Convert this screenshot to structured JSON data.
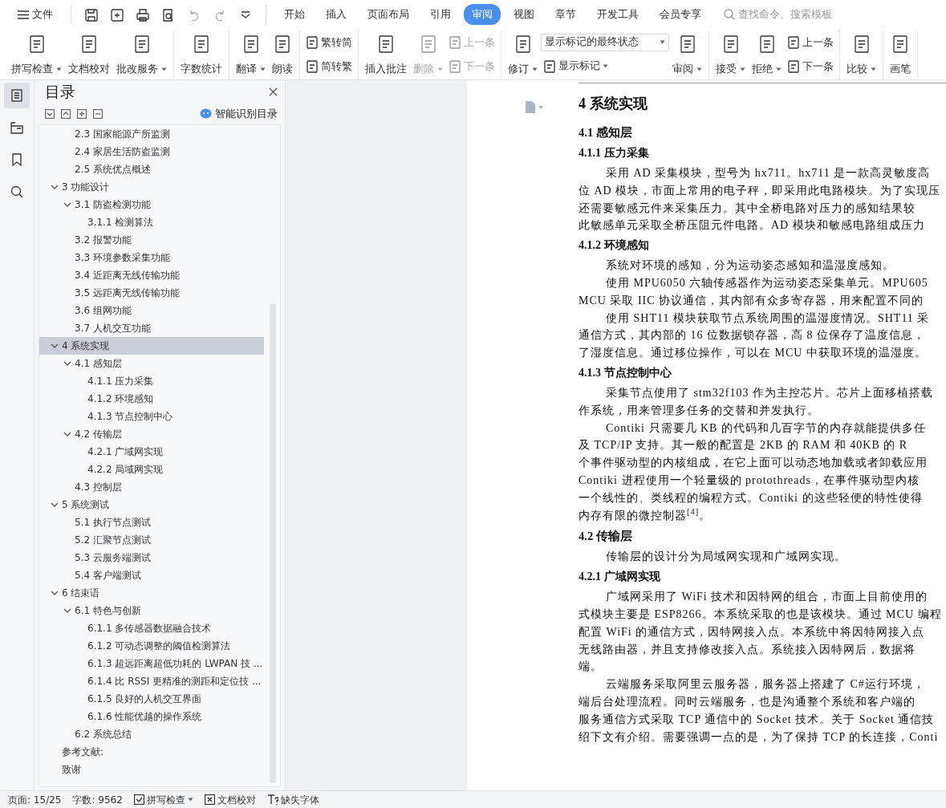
{
  "menu": {
    "label": "文件"
  },
  "tabs": [
    {
      "label": "开始",
      "selected": false
    },
    {
      "label": "插入",
      "selected": false
    },
    {
      "label": "页面布局",
      "selected": false
    },
    {
      "label": "引用",
      "selected": false
    },
    {
      "label": "审阅",
      "selected": true
    },
    {
      "label": "视图",
      "selected": false
    },
    {
      "label": "章节",
      "selected": false
    },
    {
      "label": "开发工具",
      "selected": false
    },
    {
      "label": "会员专享",
      "selected": false
    }
  ],
  "search": {
    "placeholder": "查找命令、搜索模板"
  },
  "ribbon": {
    "groups": [
      {
        "items": [
          {
            "kind": "large",
            "label": "拼写检查",
            "dropdown": true,
            "disabled": false
          },
          {
            "kind": "large",
            "label": "文档校对",
            "dropdown": false,
            "disabled": false
          },
          {
            "kind": "large",
            "label": "批改服务",
            "dropdown": true,
            "disabled": false
          }
        ]
      },
      {
        "items": [
          {
            "kind": "large",
            "label": "字数统计",
            "dropdown": false,
            "disabled": false
          }
        ]
      },
      {
        "items": [
          {
            "kind": "large",
            "label": "翻译",
            "dropdown": true,
            "disabled": false
          },
          {
            "kind": "large",
            "label": "朗读",
            "dropdown": false,
            "disabled": false
          }
        ]
      },
      {
        "items": [
          {
            "kind": "stack",
            "items": [
              {
                "kind": "small",
                "label": "繁转简",
                "dropdown": false,
                "disabled": false
              },
              {
                "kind": "small",
                "label": "简转繁",
                "dropdown": false,
                "disabled": false
              }
            ]
          }
        ]
      },
      {
        "items": [
          {
            "kind": "large",
            "label": "插入批注",
            "dropdown": false,
            "disabled": false
          },
          {
            "kind": "large",
            "label": "删除",
            "dropdown": true,
            "disabled": true
          },
          {
            "kind": "stack",
            "items": [
              {
                "kind": "small",
                "label": "上一条",
                "dropdown": false,
                "disabled": true
              },
              {
                "kind": "small",
                "label": "下一条",
                "dropdown": false,
                "disabled": true
              }
            ]
          }
        ]
      },
      {
        "items": [
          {
            "kind": "large",
            "label": "修订",
            "dropdown": true,
            "disabled": false
          },
          {
            "kind": "stack",
            "items": [
              {
                "kind": "select",
                "value": "显示标记的最终状态"
              },
              {
                "kind": "small",
                "label": "显示标记",
                "dropdown": true,
                "disabled": false
              }
            ]
          },
          {
            "kind": "large",
            "label": "审阅",
            "dropdown": true,
            "disabled": false
          }
        ]
      },
      {
        "items": [
          {
            "kind": "large",
            "label": "接受",
            "dropdown": true,
            "disabled": false
          },
          {
            "kind": "large",
            "label": "拒绝",
            "dropdown": true,
            "disabled": false
          },
          {
            "kind": "stack",
            "items": [
              {
                "kind": "small",
                "label": "上一条",
                "dropdown": false,
                "disabled": false
              },
              {
                "kind": "small",
                "label": "下一条",
                "dropdown": false,
                "disabled": false
              }
            ]
          }
        ]
      },
      {
        "items": [
          {
            "kind": "large",
            "label": "比较",
            "dropdown": true,
            "disabled": false
          }
        ]
      },
      {
        "items": [
          {
            "kind": "large",
            "label": "画笔",
            "dropdown": false,
            "disabled": false
          }
        ]
      }
    ]
  },
  "rail": [
    {
      "selected": true
    },
    {
      "selected": false
    },
    {
      "selected": false
    },
    {
      "selected": false
    }
  ],
  "toc_panel": {
    "title": "目录",
    "smart_button": "智能识别目录",
    "entries": [
      {
        "children": [
          {
            "label": "2.3  国家能源产所监测",
            "selected": false
          },
          {
            "label": "2.4  家居生活防盗监测",
            "selected": false
          },
          {
            "label": "2.5  系统优点概述",
            "selected": false
          }
        ]
      },
      {
        "label": "3  功能设计",
        "selected": false,
        "expanded": true,
        "children": [
          {
            "label": "3.1  防盗检测功能",
            "selected": false,
            "expanded": true,
            "children": [
              {
                "label": "3.1.1  检测算法",
                "selected": false
              }
            ]
          },
          {
            "label": "3.2  报警功能",
            "selected": false
          },
          {
            "label": "3.3  环境参数采集功能",
            "selected": false
          },
          {
            "label": "3.4  近距离无线传输功能",
            "selected": false
          },
          {
            "label": "3.5  远距离无线传输功能",
            "selected": false
          },
          {
            "label": "3.6  组网功能",
            "selected": false
          },
          {
            "label": "3.7  人机交互功能",
            "selected": false
          }
        ]
      },
      {
        "label": "4  系统实现",
        "selected": true,
        "expanded": true,
        "children": [
          {
            "label": "4.1  感知层",
            "selected": false,
            "expanded": true,
            "children": [
              {
                "label": "4.1.1  压力采集",
                "selected": false
              },
              {
                "label": "4.1.2  环境感知",
                "selected": false
              },
              {
                "label": "4.1.3  节点控制中心",
                "selected": false
              }
            ]
          },
          {
            "label": "4.2  传输层",
            "selected": false,
            "expanded": true,
            "children": [
              {
                "label": "4.2.1  广域网实现",
                "selected": false
              },
              {
                "label": "4.2.2  局域网实现",
                "selected": false
              }
            ]
          },
          {
            "label": "4.3  控制层",
            "selected": false
          }
        ]
      },
      {
        "label": "5  系统测试",
        "selected": false,
        "expanded": true,
        "children": [
          {
            "label": "5.1  执行节点测试",
            "selected": false
          },
          {
            "label": "5.2  汇聚节点测试",
            "selected": false
          },
          {
            "label": "5.3  云服务端测试",
            "selected": false
          },
          {
            "label": "5.4  客户端测试",
            "selected": false
          }
        ]
      },
      {
        "label": "6  结束语",
        "selected": false,
        "expanded": true,
        "children": [
          {
            "label": "6.1  特色与创新",
            "selected": false,
            "expanded": true,
            "children": [
              {
                "label": "6.1.1  多传感器数据融合技术",
                "selected": false
              },
              {
                "label": "6.1.2  可动态调整的阈值检测算法",
                "selected": false
              },
              {
                "label": "6.1.3  超远距离超低功耗的 LWPAN 技 ...",
                "selected": false
              },
              {
                "label": "6.1.4  比 RSSI 更精准的测距和定位技 ...",
                "selected": false
              },
              {
                "label": "6.1.5  良好的人机交互界面",
                "selected": false
              },
              {
                "label": "6.1.6  性能优越的操作系统",
                "selected": false
              }
            ]
          },
          {
            "label": "6.2  系统总结",
            "selected": false
          }
        ]
      },
      {
        "label": "参考文献:",
        "selected": false
      },
      {
        "label": "致谢",
        "selected": false
      }
    ]
  },
  "document": {
    "blocks": [
      {
        "kind": "h1",
        "text": "4  系统实现"
      },
      {
        "kind": "h2",
        "text": "4.1  感知层"
      },
      {
        "kind": "h3",
        "text": "4.1.1  压力采集"
      },
      {
        "kind": "line",
        "indent": true,
        "text": "采用 AD 采集模块，型号为 hx711。hx711 是一款高灵敏度高"
      },
      {
        "kind": "line",
        "indent": false,
        "text": "位 AD 模块，市面上常用的电子秤，即采用此电路模块。为了实现压"
      },
      {
        "kind": "line",
        "indent": false,
        "text": "还需要敏感元件来采集压力。其中全桥电路对压力的感知结果较"
      },
      {
        "kind": "line",
        "indent": false,
        "text": "此敏感单元采取全桥压阻元件电路。AD 模块和敏感电路组成压力"
      },
      {
        "kind": "h3",
        "text": "4.1.2  环境感知"
      },
      {
        "kind": "line",
        "indent": true,
        "text": "系统对环境的感知，分为运动姿态感知和温湿度感知。"
      },
      {
        "kind": "line",
        "indent": true,
        "text": "使用 MPU6050 六轴传感器作为运动姿态采集单元。MPU605"
      },
      {
        "kind": "line",
        "indent": false,
        "text": "MCU 采取 IIC 协议通信，其内部有众多寄存器，用来配置不同的"
      },
      {
        "kind": "line",
        "indent": true,
        "text": "使用 SHT11 模块获取节点系统周围的温湿度情况。SHT11 采"
      },
      {
        "kind": "line",
        "indent": false,
        "text": "通信方式，其内部的 16 位数据锁存器，高 8 位保存了温度信息，"
      },
      {
        "kind": "line",
        "indent": false,
        "text": "了湿度信息。通过移位操作，可以在 MCU 中获取环境的温湿度。"
      },
      {
        "kind": "h3",
        "text": "4.1.3  节点控制中心"
      },
      {
        "kind": "line",
        "indent": true,
        "text": "采集节点使用了 stm32f103 作为主控芯片。芯片上面移植搭载"
      },
      {
        "kind": "line",
        "indent": false,
        "text": "作系统，用来管理多任务的交替和并发执行。"
      },
      {
        "kind": "line",
        "indent": true,
        "text": "Contiki 只需要几 KB 的代码和几百字节的内存就能提供多任"
      },
      {
        "kind": "line",
        "indent": false,
        "text": "及 TCP/IP 支持。其一般的配置是 2KB 的 RAM 和 40KB 的 R"
      },
      {
        "kind": "line",
        "indent": false,
        "text": "个事件驱动型的内核组成，在它上面可以动态地加载或者卸载应用"
      },
      {
        "kind": "line",
        "indent": false,
        "text": "Contiki 进程使用一个轻量级的 protothreads，在事件驱动型内核"
      },
      {
        "kind": "line",
        "indent": false,
        "text": "一个线性的、类线程的编程方式。Contiki 的这些轻便的特性使得"
      },
      {
        "kind": "line",
        "indent": false,
        "text": "内存有限的微控制器$^{[4]}$。"
      },
      {
        "kind": "h2",
        "text": "4.2  传输层"
      },
      {
        "kind": "line",
        "indent": true,
        "text": "传输层的设计分为局域网实现和广域网实现。"
      },
      {
        "kind": "h3",
        "text": "4.2.1  广域网实现"
      },
      {
        "kind": "line",
        "indent": true,
        "text": "广域网采用了 WiFi 技术和因特网的组合，市面上目前使用的"
      },
      {
        "kind": "line",
        "indent": false,
        "text": "式模块主要是 ESP8266。本系统采取的也是该模块。通过 MCU 编程"
      },
      {
        "kind": "line",
        "indent": false,
        "text": "配置 WiFi 的通信方式，因特网接入点。本系统中将因特网接入点"
      },
      {
        "kind": "line",
        "indent": false,
        "text": "无线路由器，并且支持修改接入点。系统接入因特网后，数据将"
      },
      {
        "kind": "line",
        "indent": false,
        "text": "端。"
      },
      {
        "kind": "line",
        "indent": true,
        "text": "云端服务采取阿里云服务器，服务器上搭建了 C#运行环境，"
      },
      {
        "kind": "line",
        "indent": false,
        "text": "端后台处理流程。同时云端服务，也是沟通整个系统和客户端的"
      },
      {
        "kind": "line",
        "indent": false,
        "text": "服务通信方式采取 TCP 通信中的 Socket 技术。关于 Socket 通信技"
      },
      {
        "kind": "line",
        "indent": false,
        "text": "绍下文有介绍。需要强调一点的是，为了保持 TCP 的长连接，Conti"
      }
    ]
  },
  "status_bar": {
    "page": "页面: 15/25",
    "words": "字数: 9562",
    "spell": "拼写检查",
    "proof": "文档校对",
    "fonts": "缺失字体"
  }
}
